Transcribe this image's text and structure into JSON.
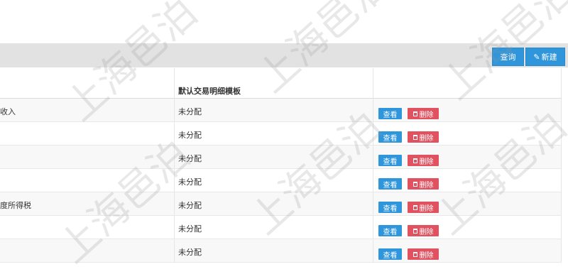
{
  "toolbar": {
    "query_label": "查询",
    "new_label": "新建",
    "new_icon": "pencil-icon"
  },
  "table": {
    "header": {
      "name": "",
      "template": "默认交易明细模板"
    },
    "rows": [
      {
        "name": "收入",
        "template": "未分配",
        "view": "查看",
        "delete": "删除"
      },
      {
        "name": "",
        "template": "未分配",
        "view": "查看",
        "delete": "删除"
      },
      {
        "name": "",
        "template": "未分配",
        "view": "查看",
        "delete": "删除"
      },
      {
        "name": "",
        "template": "未分配",
        "view": "查看",
        "delete": "删除"
      },
      {
        "name": "度所得税",
        "template": "未分配",
        "view": "查看",
        "delete": "删除"
      },
      {
        "name": "",
        "template": "未分配",
        "view": "查看",
        "delete": "删除"
      },
      {
        "name": "",
        "template": "未分配",
        "view": "查看",
        "delete": "删除"
      }
    ]
  },
  "watermark": {
    "text": "上海邑泊"
  },
  "colors": {
    "accent": "#2f96dc",
    "danger": "#e05260",
    "toolbar_bg": "#e2e2e2"
  }
}
